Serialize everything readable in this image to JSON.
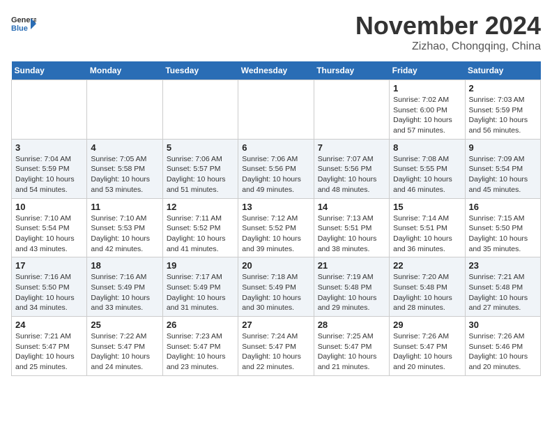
{
  "logo": {
    "general": "General",
    "blue": "Blue"
  },
  "header": {
    "month": "November 2024",
    "location": "Zizhao, Chongqing, China"
  },
  "weekdays": [
    "Sunday",
    "Monday",
    "Tuesday",
    "Wednesday",
    "Thursday",
    "Friday",
    "Saturday"
  ],
  "weeks": [
    [
      {
        "day": "",
        "info": ""
      },
      {
        "day": "",
        "info": ""
      },
      {
        "day": "",
        "info": ""
      },
      {
        "day": "",
        "info": ""
      },
      {
        "day": "",
        "info": ""
      },
      {
        "day": "1",
        "info": "Sunrise: 7:02 AM\nSunset: 6:00 PM\nDaylight: 10 hours and 57 minutes."
      },
      {
        "day": "2",
        "info": "Sunrise: 7:03 AM\nSunset: 5:59 PM\nDaylight: 10 hours and 56 minutes."
      }
    ],
    [
      {
        "day": "3",
        "info": "Sunrise: 7:04 AM\nSunset: 5:59 PM\nDaylight: 10 hours and 54 minutes."
      },
      {
        "day": "4",
        "info": "Sunrise: 7:05 AM\nSunset: 5:58 PM\nDaylight: 10 hours and 53 minutes."
      },
      {
        "day": "5",
        "info": "Sunrise: 7:06 AM\nSunset: 5:57 PM\nDaylight: 10 hours and 51 minutes."
      },
      {
        "day": "6",
        "info": "Sunrise: 7:06 AM\nSunset: 5:56 PM\nDaylight: 10 hours and 49 minutes."
      },
      {
        "day": "7",
        "info": "Sunrise: 7:07 AM\nSunset: 5:56 PM\nDaylight: 10 hours and 48 minutes."
      },
      {
        "day": "8",
        "info": "Sunrise: 7:08 AM\nSunset: 5:55 PM\nDaylight: 10 hours and 46 minutes."
      },
      {
        "day": "9",
        "info": "Sunrise: 7:09 AM\nSunset: 5:54 PM\nDaylight: 10 hours and 45 minutes."
      }
    ],
    [
      {
        "day": "10",
        "info": "Sunrise: 7:10 AM\nSunset: 5:54 PM\nDaylight: 10 hours and 43 minutes."
      },
      {
        "day": "11",
        "info": "Sunrise: 7:10 AM\nSunset: 5:53 PM\nDaylight: 10 hours and 42 minutes."
      },
      {
        "day": "12",
        "info": "Sunrise: 7:11 AM\nSunset: 5:52 PM\nDaylight: 10 hours and 41 minutes."
      },
      {
        "day": "13",
        "info": "Sunrise: 7:12 AM\nSunset: 5:52 PM\nDaylight: 10 hours and 39 minutes."
      },
      {
        "day": "14",
        "info": "Sunrise: 7:13 AM\nSunset: 5:51 PM\nDaylight: 10 hours and 38 minutes."
      },
      {
        "day": "15",
        "info": "Sunrise: 7:14 AM\nSunset: 5:51 PM\nDaylight: 10 hours and 36 minutes."
      },
      {
        "day": "16",
        "info": "Sunrise: 7:15 AM\nSunset: 5:50 PM\nDaylight: 10 hours and 35 minutes."
      }
    ],
    [
      {
        "day": "17",
        "info": "Sunrise: 7:16 AM\nSunset: 5:50 PM\nDaylight: 10 hours and 34 minutes."
      },
      {
        "day": "18",
        "info": "Sunrise: 7:16 AM\nSunset: 5:49 PM\nDaylight: 10 hours and 33 minutes."
      },
      {
        "day": "19",
        "info": "Sunrise: 7:17 AM\nSunset: 5:49 PM\nDaylight: 10 hours and 31 minutes."
      },
      {
        "day": "20",
        "info": "Sunrise: 7:18 AM\nSunset: 5:49 PM\nDaylight: 10 hours and 30 minutes."
      },
      {
        "day": "21",
        "info": "Sunrise: 7:19 AM\nSunset: 5:48 PM\nDaylight: 10 hours and 29 minutes."
      },
      {
        "day": "22",
        "info": "Sunrise: 7:20 AM\nSunset: 5:48 PM\nDaylight: 10 hours and 28 minutes."
      },
      {
        "day": "23",
        "info": "Sunrise: 7:21 AM\nSunset: 5:48 PM\nDaylight: 10 hours and 27 minutes."
      }
    ],
    [
      {
        "day": "24",
        "info": "Sunrise: 7:21 AM\nSunset: 5:47 PM\nDaylight: 10 hours and 25 minutes."
      },
      {
        "day": "25",
        "info": "Sunrise: 7:22 AM\nSunset: 5:47 PM\nDaylight: 10 hours and 24 minutes."
      },
      {
        "day": "26",
        "info": "Sunrise: 7:23 AM\nSunset: 5:47 PM\nDaylight: 10 hours and 23 minutes."
      },
      {
        "day": "27",
        "info": "Sunrise: 7:24 AM\nSunset: 5:47 PM\nDaylight: 10 hours and 22 minutes."
      },
      {
        "day": "28",
        "info": "Sunrise: 7:25 AM\nSunset: 5:47 PM\nDaylight: 10 hours and 21 minutes."
      },
      {
        "day": "29",
        "info": "Sunrise: 7:26 AM\nSunset: 5:47 PM\nDaylight: 10 hours and 20 minutes."
      },
      {
        "day": "30",
        "info": "Sunrise: 7:26 AM\nSunset: 5:46 PM\nDaylight: 10 hours and 20 minutes."
      }
    ]
  ]
}
